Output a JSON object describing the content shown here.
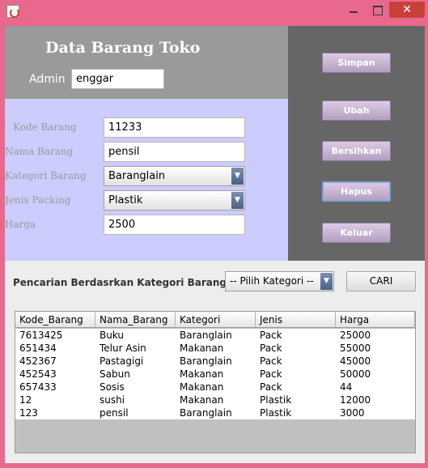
{
  "window": {
    "title": "",
    "controls": {
      "minimize": "minimize-icon",
      "maximize": "maximize-icon",
      "close": "close-icon"
    }
  },
  "header": {
    "title": "Data Barang Toko",
    "admin_label": "Admin",
    "admin_value": "enggar"
  },
  "form": {
    "kode_label": "Kode Barang",
    "kode_value": "11233",
    "nama_label": "Nama Barang",
    "nama_value": "pensil",
    "kategori_label": "Kategori Barang",
    "kategori_value": "Baranglain",
    "packing_label": "Jenis Packing",
    "packing_value": "Plastik",
    "harga_label": "Harga",
    "harga_value": "2500"
  },
  "actions": {
    "simpan": "Simpan",
    "ubah": "Ubah",
    "bersihkan": "Bersihkan",
    "hapus": "Hapus",
    "keluar": "Keluar"
  },
  "search": {
    "label": "Pencarian Berdasrkan Kategori Barang",
    "select_value": "-- Pilih Kategori --",
    "button": "CARI"
  },
  "table": {
    "columns": [
      "Kode_Barang",
      "Nama_Barang",
      "Kategori",
      "Jenis",
      "Harga"
    ],
    "rows": [
      [
        "7613425",
        "Buku",
        "Baranglain",
        "Pack",
        "25000"
      ],
      [
        "651434",
        "Telur Asin",
        "Makanan",
        "Pack",
        "55000"
      ],
      [
        "452367",
        "Pastagigi",
        "Baranglain",
        "Pack",
        "45000"
      ],
      [
        "452543",
        "Sabun",
        "Makanan",
        "Pack",
        "50000"
      ],
      [
        "657433",
        "Sosis",
        "Makanan",
        "Pack",
        "44"
      ],
      [
        "12",
        "sushi",
        "Makanan",
        "Plastik",
        "12000"
      ],
      [
        "123",
        "pensil",
        "Baranglain",
        "Plastik",
        "3000"
      ]
    ]
  },
  "colors": {
    "frame": "#e8698d",
    "close": "#c9403a",
    "header_panel": "#9a9a9a",
    "form_panel": "#ccccff",
    "side_panel": "#666666",
    "action_button": "#c5b3d3"
  }
}
